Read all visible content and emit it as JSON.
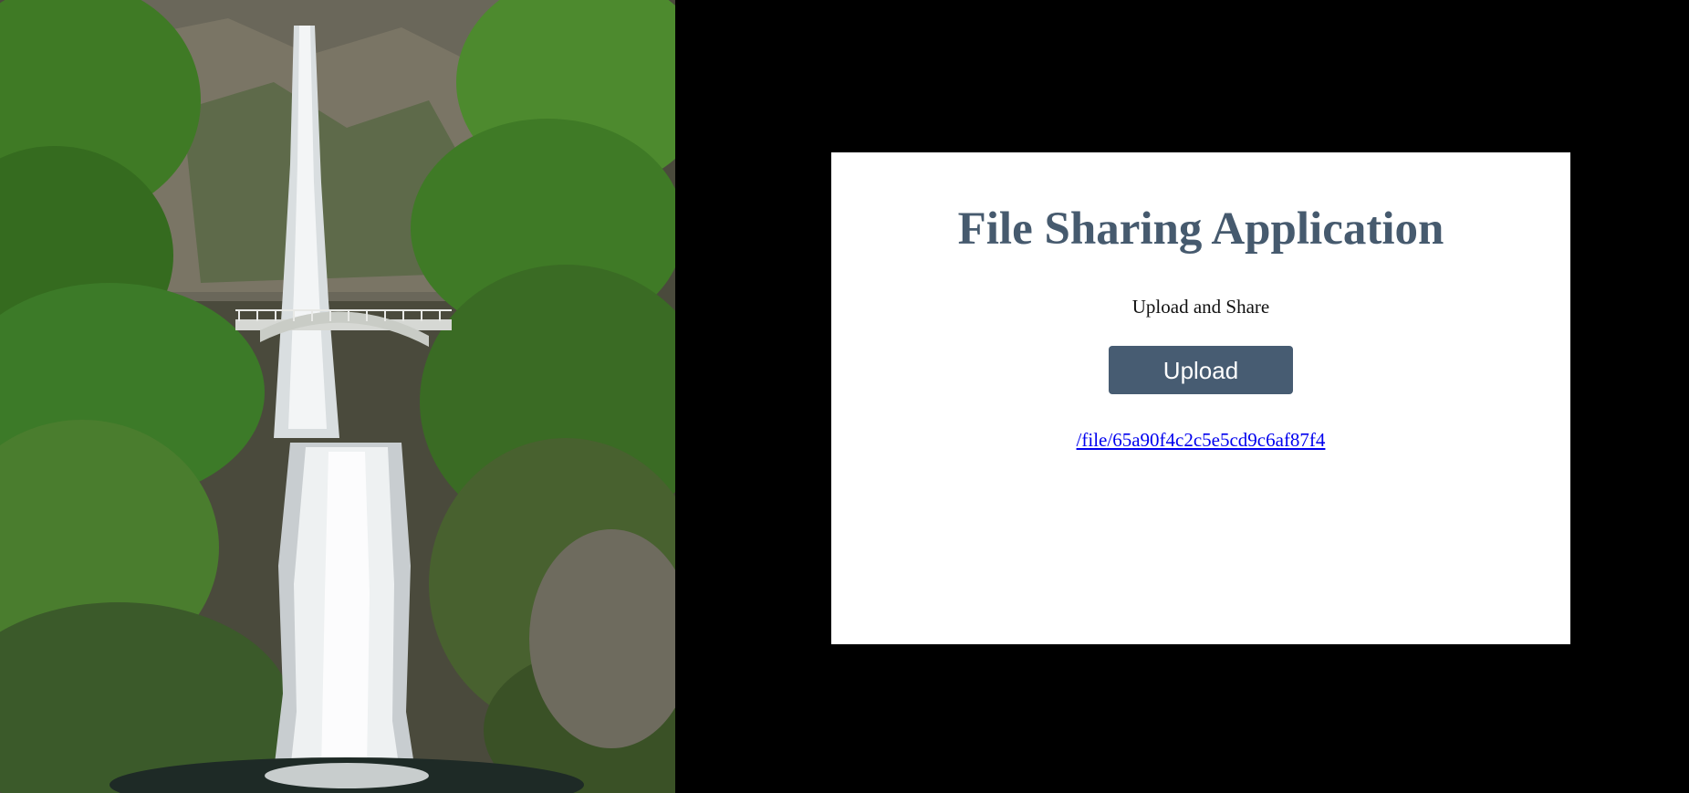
{
  "photo": {
    "icon": "waterfall-photo",
    "description_alt": ""
  },
  "card": {
    "title": "File Sharing Application",
    "subtitle": "Upload and Share",
    "upload_button_label": "Upload",
    "file_link_text": "/file/65a90f4c2c5e5cd9c6af87f4"
  },
  "colors": {
    "page_background": "#000000",
    "card_background": "#ffffff",
    "title_color": "#465a6e",
    "button_background": "#475c72",
    "button_text": "#ffffff",
    "link_color": "#0000ee"
  }
}
